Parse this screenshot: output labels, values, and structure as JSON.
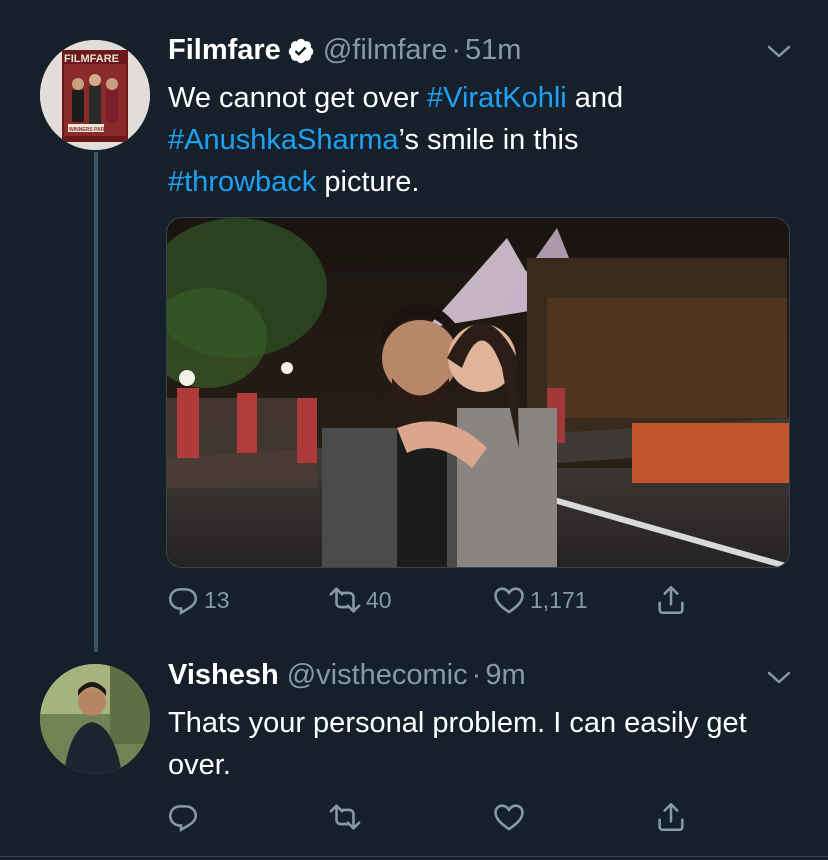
{
  "tweets": [
    {
      "author_name": "Filmfare",
      "verified": true,
      "handle": "@filmfare",
      "separator": "·",
      "time": "51m",
      "text_parts": [
        {
          "text": "We cannot get over ",
          "type": "text"
        },
        {
          "text": "#ViratKohli",
          "type": "hashtag"
        },
        {
          "text": " and ",
          "type": "text"
        },
        {
          "text": "#AnushkaSharma",
          "type": "hashtag"
        },
        {
          "text": "’s smile in this ",
          "type": "text"
        },
        {
          "text": "#throwback",
          "type": "hashtag"
        },
        {
          "text": " picture.",
          "type": "text"
        }
      ],
      "avatar_text": "FILMFARE",
      "avatar_sub": "WINNERS PARADE",
      "counts": {
        "reply": "13",
        "retweet": "40",
        "like": "1,171"
      }
    },
    {
      "author_name": "Vishesh",
      "verified": false,
      "handle": "@visthecomic",
      "separator": "·",
      "time": "9m",
      "text": "Thats your personal problem. I can easily get over.",
      "counts": {
        "reply": "",
        "retweet": "",
        "like": ""
      }
    }
  ],
  "colors": {
    "background": "#15202b",
    "accent": "#1da1f2",
    "secondary_text": "#8899a6",
    "divider": "#38444d"
  },
  "icons": [
    "verified-badge-icon",
    "chevron-down-icon",
    "reply-icon",
    "retweet-icon",
    "like-icon",
    "share-icon"
  ]
}
